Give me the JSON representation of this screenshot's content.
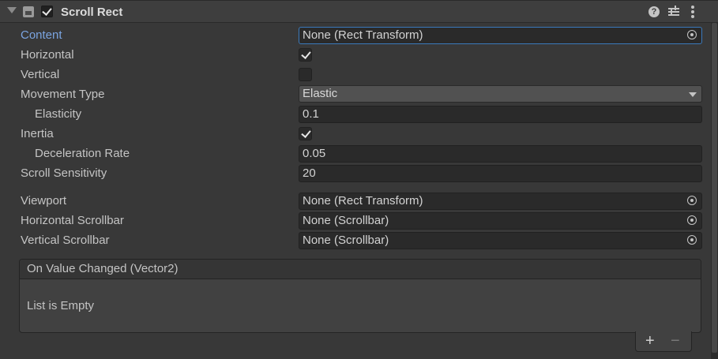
{
  "component": {
    "title": "Scroll Rect",
    "enabled": true,
    "help_glyph": "?",
    "icons": [
      "foldout-arrow-icon",
      "scroll-rect-component-icon",
      "help-icon",
      "preset-icon",
      "context-menu-icon"
    ]
  },
  "fields": {
    "content": {
      "label": "Content",
      "value": "None (Rect Transform)"
    },
    "horizontal": {
      "label": "Horizontal",
      "checked": true
    },
    "vertical": {
      "label": "Vertical",
      "checked": false
    },
    "movement_type": {
      "label": "Movement Type",
      "value": "Elastic"
    },
    "elasticity": {
      "label": "Elasticity",
      "value": "0.1"
    },
    "inertia": {
      "label": "Inertia",
      "checked": true
    },
    "deceleration_rate": {
      "label": "Deceleration Rate",
      "value": "0.05"
    },
    "scroll_sensitivity": {
      "label": "Scroll Sensitivity",
      "value": "20"
    },
    "viewport": {
      "label": "Viewport",
      "value": "None (Rect Transform)"
    },
    "horizontal_scrollbar": {
      "label": "Horizontal Scrollbar",
      "value": "None (Scrollbar)"
    },
    "vertical_scrollbar": {
      "label": "Vertical Scrollbar",
      "value": "None (Scrollbar)"
    }
  },
  "event": {
    "title": "On Value Changed (Vector2)",
    "empty_text": "List is Empty",
    "add_label": "+",
    "remove_label": "−"
  },
  "colors": {
    "background": "#383838",
    "field": "#2a2a2a",
    "accent_label": "#7ba4e0",
    "focus_border": "#3a79bb"
  }
}
